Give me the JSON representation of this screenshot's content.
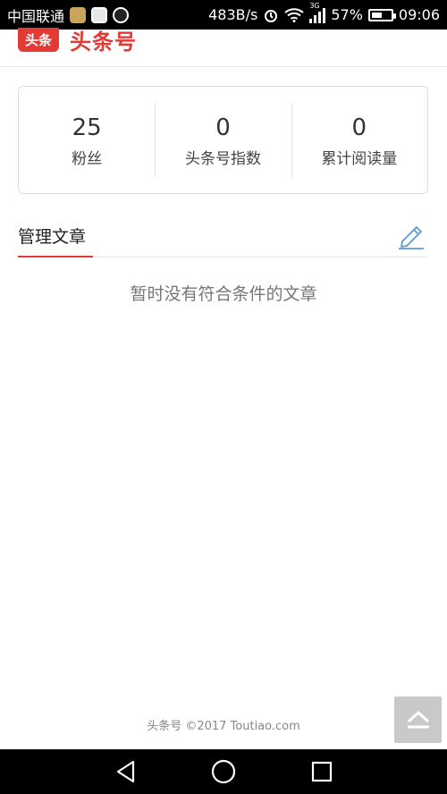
{
  "status_bar": {
    "carrier": "中国联通",
    "speed": "483B/s",
    "network": "3G",
    "battery": "57%",
    "battery_level": 0.57,
    "time": "09:06"
  },
  "header": {
    "logo_badge": "头条",
    "logo_text": "头条号"
  },
  "stats": [
    {
      "value": "25",
      "label": "粉丝"
    },
    {
      "value": "0",
      "label": "头条号指数"
    },
    {
      "value": "0",
      "label": "累计阅读量"
    }
  ],
  "section": {
    "title": "管理文章",
    "empty_message": "暂时没有符合条件的文章"
  },
  "footer": {
    "text": "头条号  ©2017 Toutiao.com"
  },
  "colors": {
    "brand": "#e23b36",
    "accent_icon": "#5b9bd5"
  },
  "icons": [
    "edit-pencil-icon",
    "chevron-up-icon",
    "back-icon",
    "home-icon",
    "recents-icon"
  ]
}
